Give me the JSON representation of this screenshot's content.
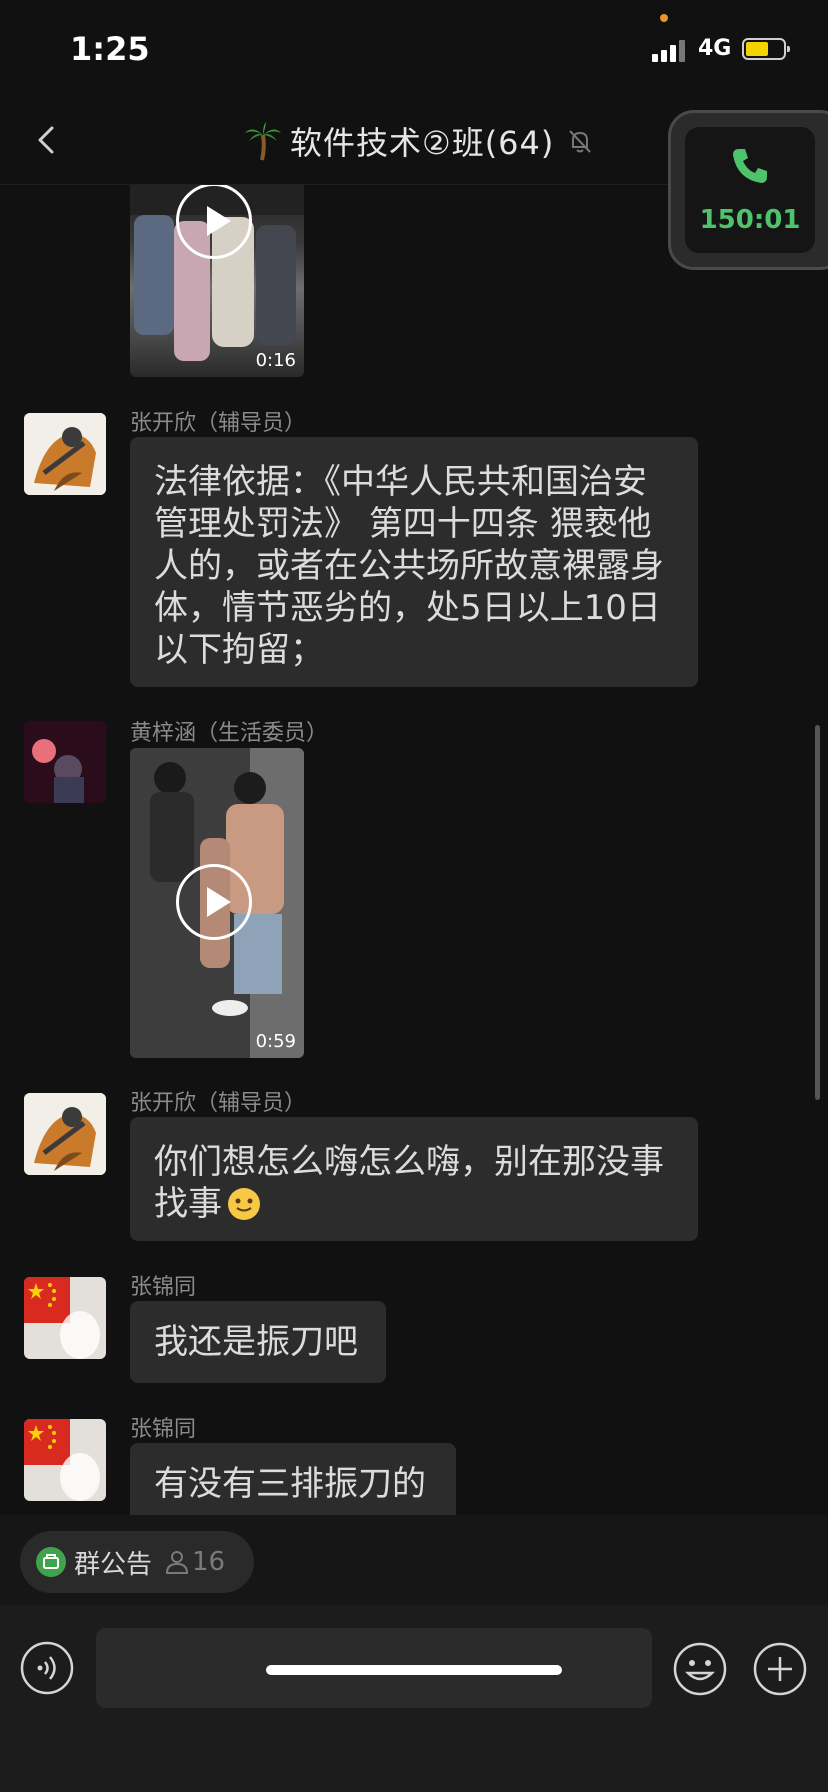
{
  "status_bar": {
    "time": "1:25",
    "network": "4G"
  },
  "header": {
    "title": "软件技术②班(64)",
    "back_icon": "chevron-left-icon",
    "title_icon": "palm-tree-icon",
    "mute_icon": "bell-slash-icon"
  },
  "call": {
    "duration": "150:01",
    "icon": "phone-icon",
    "color": "#4fc36b"
  },
  "messages": [
    {
      "type": "video",
      "duration": "0:16"
    },
    {
      "type": "text",
      "sender": "张开欣（辅导员）",
      "lines": [
        "法律依据：《中华人民共和国治安",
        "管理处罚法》 第四十四条 猥亵他",
        "人的，或者在公共场所故意裸露身",
        "体，情节恶劣的，处5日以上10日",
        "以下拘留；"
      ]
    },
    {
      "type": "video",
      "sender": "黄梓涵（生活委员）",
      "duration": "0:59"
    },
    {
      "type": "text",
      "sender": "张开欣（辅导员）",
      "lines": [
        "你们想怎么嗨怎么嗨，别在那没事",
        "找事"
      ]
    },
    {
      "type": "text",
      "sender": "张锦同",
      "text": "我还是振刀吧"
    },
    {
      "type": "text",
      "sender": "张锦同",
      "text": "有没有三排振刀的"
    }
  ],
  "announcement": {
    "label": "群公告",
    "count": "16",
    "icon": "announcement-icon",
    "member_icon": "person-icon"
  },
  "input": {
    "placeholder": "",
    "voice_icon": "voice-icon",
    "emoji_icon": "emoji-icon",
    "plus_icon": "plus-icon"
  },
  "colors": {
    "background": "#111111",
    "bubble": "#2c2c2c",
    "accent": "#4fc36b"
  }
}
